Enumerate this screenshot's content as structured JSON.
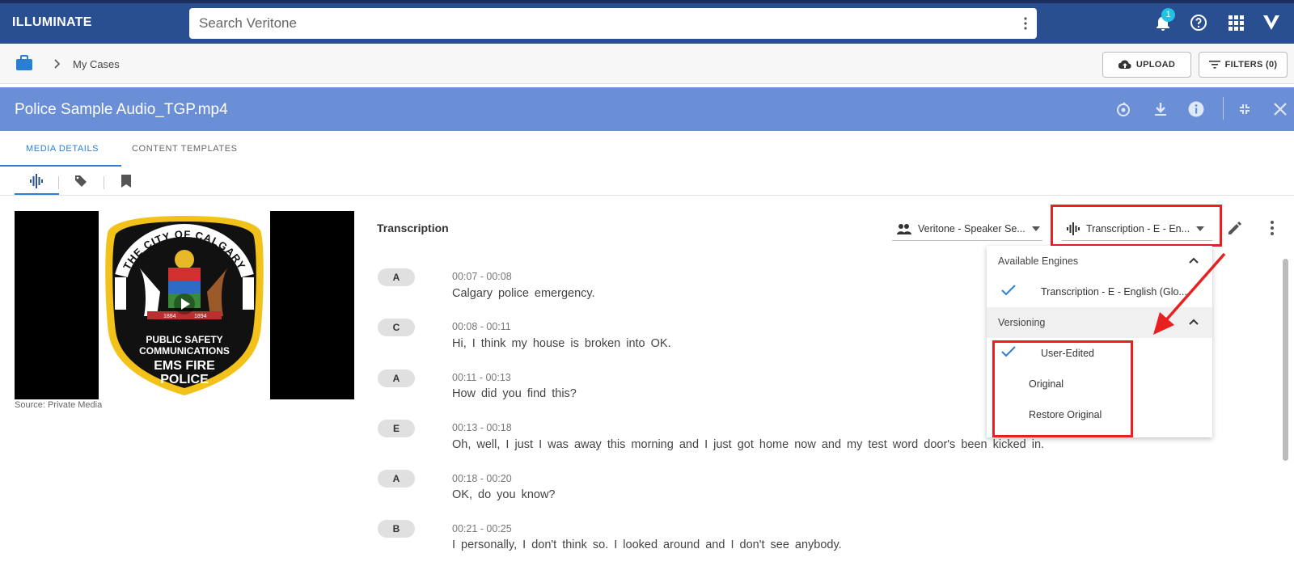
{
  "app": {
    "brand": "ILLUMINATE"
  },
  "search": {
    "placeholder": "Search Veritone"
  },
  "notifications": {
    "count": "1"
  },
  "breadcrumb": {
    "label": "My Cases"
  },
  "toolbar": {
    "upload_label": "UPLOAD",
    "filters_label": "FILTERS (0)"
  },
  "media": {
    "title": "Police Sample Audio_TGP.mp4",
    "source": "Source: Private Media"
  },
  "tabs": [
    {
      "label": "MEDIA DETAILS"
    },
    {
      "label": "CONTENT TEMPLATES"
    }
  ],
  "badge_text": {
    "line1": "THE CITY OF CALGARY",
    "line2": "PUBLIC SAFETY",
    "line3": "COMMUNICATIONS",
    "line4": "EMS FIRE",
    "line5": "POLICE",
    "year_left": "1884",
    "year_right": "1894"
  },
  "transcription": {
    "title": "Transcription",
    "speaker_engine": "Veritone - Speaker Se...",
    "transcription_engine": "Transcription - E - En...",
    "rows": [
      {
        "speaker": "A",
        "time": "00:07 - 00:08",
        "text": "Calgary police emergency."
      },
      {
        "speaker": "C",
        "time": "00:08 - 00:11",
        "text": "Hi, I think my house is broken into OK."
      },
      {
        "speaker": "A",
        "time": "00:11 - 00:13",
        "text": "How did you find this?"
      },
      {
        "speaker": "E",
        "time": "00:13 - 00:18",
        "text": "Oh, well, I just I was away this morning and I just got home now and my test word door's been kicked in."
      },
      {
        "speaker": "A",
        "time": "00:18 - 00:20",
        "text": "OK, do you know?"
      },
      {
        "speaker": "B",
        "time": "00:21 - 00:25",
        "text": "I personally, I don't think so. I looked around and I don't see anybody."
      }
    ]
  },
  "engine_menu": {
    "available_label": "Available Engines",
    "engine_item": "Transcription - E - English (Glo...",
    "versioning_label": "Versioning",
    "versions": [
      "User-Edited",
      "Original",
      "Restore Original"
    ]
  },
  "colors": {
    "topbar": "#2a4f90",
    "media_header": "#6a8fd6",
    "accent": "#2a7fd4",
    "highlight": "#e82020"
  }
}
